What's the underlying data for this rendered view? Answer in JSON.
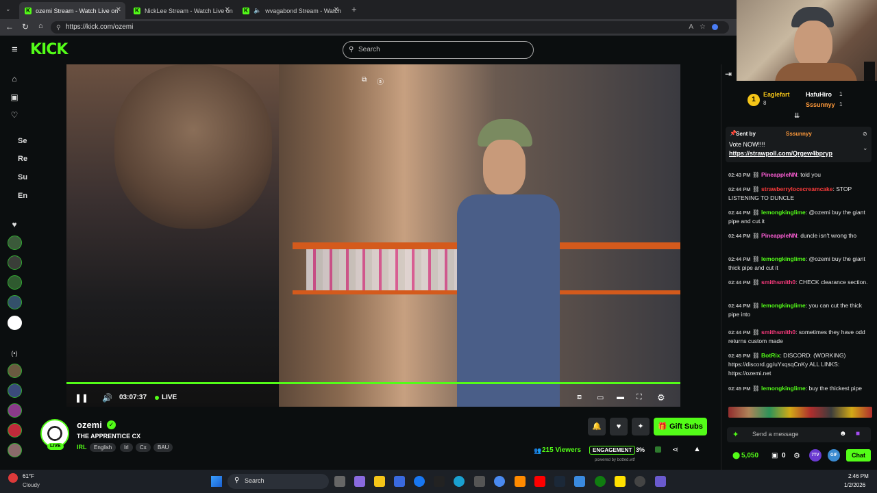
{
  "browser": {
    "tabs": [
      {
        "title": "ozemi Stream - Watch Live on"
      },
      {
        "title": "NickLee Stream - Watch Live on K"
      },
      {
        "title": "wvagabond Stream - Watch L"
      }
    ],
    "url": "https://kick.com/ozemi"
  },
  "header": {
    "logo": "KICK",
    "search_placeholder": "Search"
  },
  "leftnav": {
    "items": [
      "Se",
      "Re",
      "Su",
      "En"
    ]
  },
  "player": {
    "time": "03:07:37",
    "live_label": "LIVE"
  },
  "stream": {
    "streamer": "ozemi",
    "live_badge": "LIVE",
    "title": "THE APPRENTICE CX",
    "category": "IRL",
    "tags": [
      "English",
      "Irl",
      "Cx",
      "BAU"
    ],
    "gift_subs_label": "Gift Subs",
    "viewers": "215 Viewers",
    "engagement_label": "ENGAGEMENT",
    "engagement_value": "3%",
    "powered_by": "powered by botted.wtf"
  },
  "chat": {
    "leaderboard": {
      "first_name": "Eaglefart",
      "first_count": "8",
      "second_name": "HafuHiro",
      "second_count": "1",
      "third_name": "Sssunnyy",
      "third_count": "1"
    },
    "pinned": {
      "sent_by_label": "Sent by",
      "sent_by_user": "Sssunnyy",
      "text": "Vote NOW!!!!",
      "link": "https://strawpoll.com/Qrgew4bpryp"
    },
    "messages": [
      {
        "time": "02:43 PM",
        "user": "PineappleNN",
        "color": "#ff5fd7",
        "text": ": told you"
      },
      {
        "time": "02:44 PM",
        "user": "strawberrylocecreamcake",
        "color": "#ff3b3b",
        "text": ": STOP LISTENING TO DUNCLE"
      },
      {
        "time": "02:44 PM",
        "user": "lemongkinglime",
        "color": "#53fc18",
        "text": ": @ozemi buy the giant pipe and cut.it"
      },
      {
        "time": "02:44 PM",
        "user": "PineappleNN",
        "color": "#ff5fd7",
        "text": ": duncle isn't wrong tho"
      },
      {
        "time": "02:44 PM",
        "user": "lemongkinglime",
        "color": "#53fc18",
        "text": ": @ozemi buy the giant thick pipe and cut it"
      },
      {
        "time": "02:44 PM",
        "user": "smithsmith0",
        "color": "#ff3b7f",
        "text": ": CHECK clearance section."
      },
      {
        "time": "02:44 PM",
        "user": "lemongkinglime",
        "color": "#53fc18",
        "text": ": you can cut the thick pipe into"
      },
      {
        "time": "02:44 PM",
        "user": "smithsmith0",
        "color": "#ff3b7f",
        "text": ": sometimes they have odd returns custom made"
      },
      {
        "time": "02:45 PM",
        "user": "BotRix",
        "color": "#53fc18",
        "text": ": DISCORD: (WORKING) https://discord.gg/uYxqsqCnKy ALL LINKS: https://ozemi.net"
      },
      {
        "time": "02:45 PM",
        "user": "lemongkinglime",
        "color": "#53fc18",
        "text": ": buy the thickest pipe"
      }
    ],
    "input_placeholder": "Send a message",
    "points": "5,050",
    "zero_count": "0",
    "chat_button": "Chat",
    "badge_7tv": "7TV",
    "badge_gif": "GIF"
  },
  "taskbar": {
    "weather_temp": "61°F",
    "weather_desc": "Cloudy",
    "search_label": "Search",
    "time": "2:46 PM",
    "date": "1/2/2026"
  },
  "colors": {
    "brand": "#53fc18",
    "bg": "#0b0e0f"
  }
}
